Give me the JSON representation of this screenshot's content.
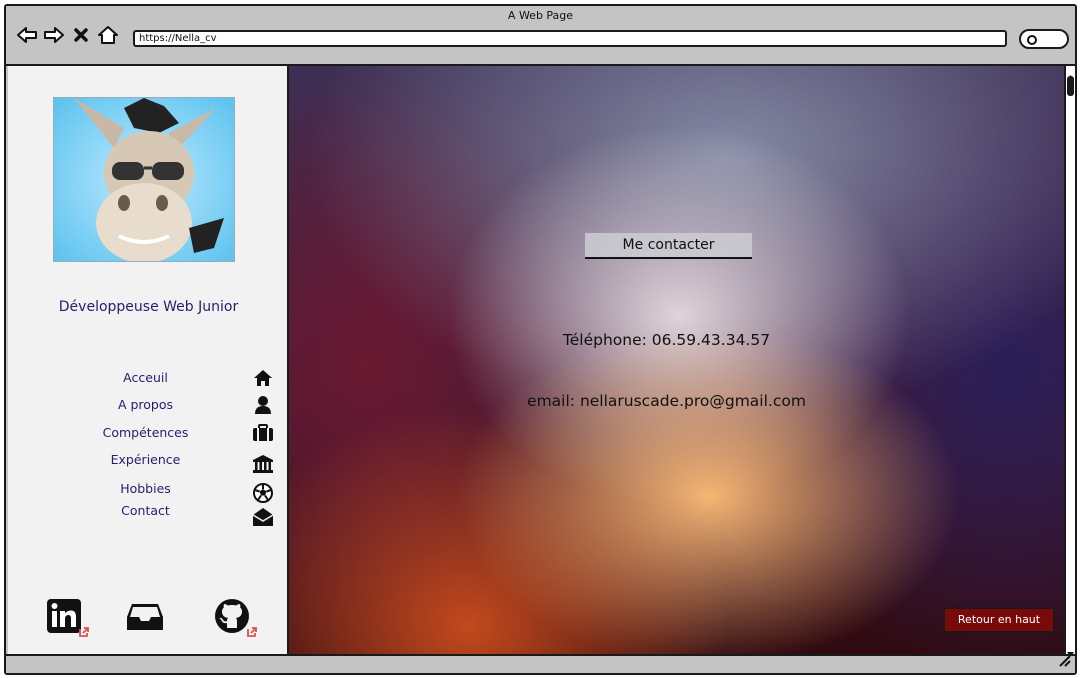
{
  "window": {
    "title": "A Web Page"
  },
  "address_bar": {
    "url": "https://Nella_cv"
  },
  "nav": {
    "icons": [
      "back-arrow-icon",
      "forward-arrow-icon",
      "close-icon",
      "home-icon"
    ]
  },
  "sidebar": {
    "role": "Développeuse Web Junior",
    "menu": [
      {
        "label": "Acceuil",
        "icon": "home-icon"
      },
      {
        "label": "A propos",
        "icon": "user-icon"
      },
      {
        "label": "Compétences",
        "icon": "briefcase-icon"
      },
      {
        "label": "Expérience",
        "icon": "institution-icon"
      },
      {
        "label": "Hobbies",
        "icon": "soccer-ball-icon"
      },
      {
        "label": "Contact",
        "icon": "envelope-open-icon"
      }
    ],
    "social": [
      {
        "icon": "linkedin-icon"
      },
      {
        "icon": "inbox-icon"
      },
      {
        "icon": "github-icon"
      }
    ]
  },
  "main": {
    "section_title": "Me contacter",
    "phone": "Téléphone: 06.59.43.34.57",
    "email": "email: nellaruscade.pro@gmail.com",
    "back_to_top": "Retour en haut"
  },
  "colors": {
    "chrome": "#c4c4c4",
    "menu_text": "#2b1a6e",
    "back_to_top_bg": "#7a0a0a",
    "external_link": "#e05050"
  }
}
